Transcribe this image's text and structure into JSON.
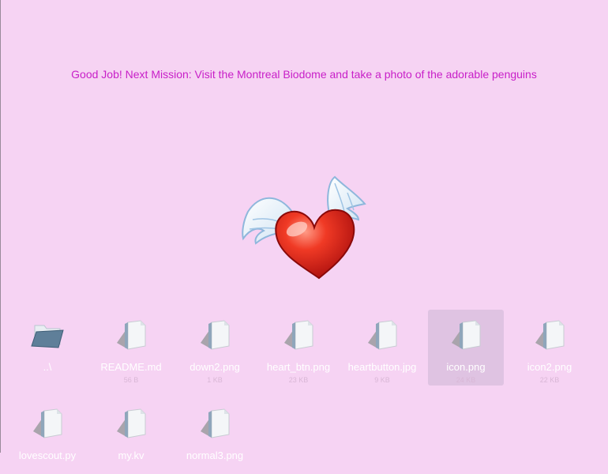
{
  "mission_text": "Good Job! Next Mission: Visit the Montreal Biodome and take a photo of the adorable penguins",
  "heart_icon": "winged-heart-icon",
  "files": [
    {
      "name": "..\\",
      "size": "",
      "icon": "folder-icon",
      "selected": false
    },
    {
      "name": "README.md",
      "size": "56 B",
      "icon": "file-icon",
      "selected": false
    },
    {
      "name": "down2.png",
      "size": "1 KB",
      "icon": "file-icon",
      "selected": false
    },
    {
      "name": "heart_btn.png",
      "size": "23 KB",
      "icon": "file-icon",
      "selected": false
    },
    {
      "name": "heartbutton.jpg",
      "size": "9 KB",
      "icon": "file-icon",
      "selected": false
    },
    {
      "name": "icon.png",
      "size": "24 KB",
      "icon": "file-icon",
      "selected": true
    },
    {
      "name": "icon2.png",
      "size": "22 KB",
      "icon": "file-icon",
      "selected": false
    },
    {
      "name": "lovescout.py",
      "size": "",
      "icon": "file-icon",
      "selected": false
    },
    {
      "name": "my.kv",
      "size": "",
      "icon": "file-icon",
      "selected": false
    },
    {
      "name": "normal3.png",
      "size": "",
      "icon": "file-icon",
      "selected": false
    }
  ]
}
